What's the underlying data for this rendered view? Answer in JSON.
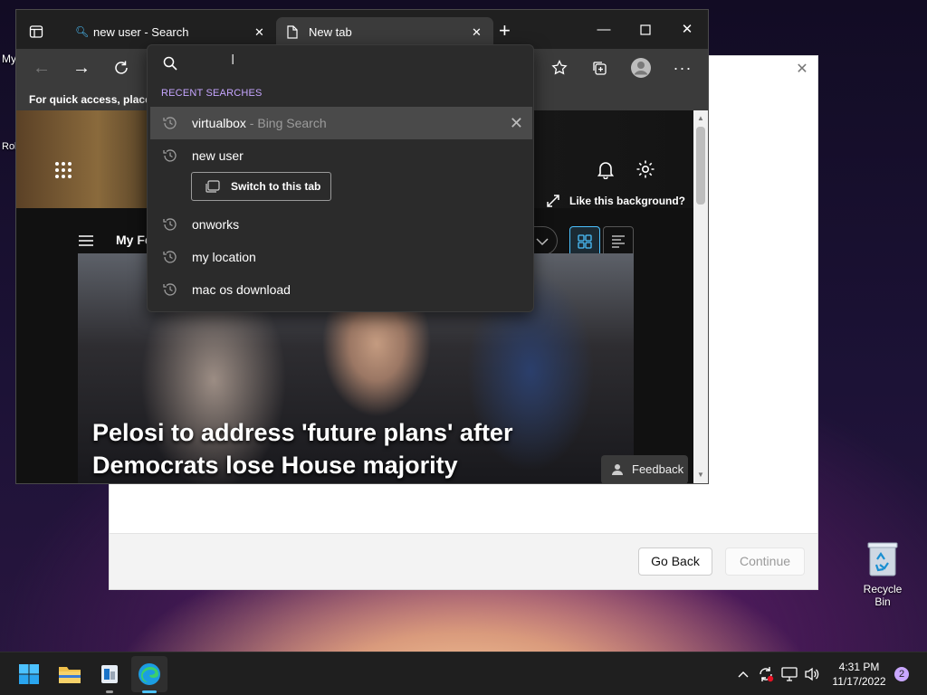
{
  "desktop": {
    "fragment_top": "My",
    "fragment_mid": "Rol",
    "recycle_bin_label": "Recycle Bin"
  },
  "dialog": {
    "go_back_label": "Go Back",
    "continue_label": "Continue"
  },
  "browser": {
    "tabs": [
      {
        "label": "new user - Search"
      },
      {
        "label": "New tab"
      }
    ],
    "favorites_bar_text": "For quick access, place y",
    "new_tab_page": {
      "my_feed_label": "My Fe",
      "like_background_label": "Like this background?",
      "headline": "Pelosi to address 'future plans' after Democrats lose House majority",
      "feedback_label": "Feedback"
    }
  },
  "address_dropdown": {
    "heading": "RECENT SEARCHES",
    "items": [
      {
        "text": "virtualbox",
        "suffix": " - Bing Search"
      },
      {
        "text": "new user"
      },
      {
        "text": "onworks"
      },
      {
        "text": "my location"
      },
      {
        "text": "mac os download"
      }
    ],
    "switch_tab_label": "Switch to this tab"
  },
  "taskbar": {
    "time": "4:31 PM",
    "date": "11/17/2022",
    "notification_count": "2"
  },
  "colors": {
    "accent": "#4cc2ff",
    "recent_heading": "#c6a6ff"
  }
}
